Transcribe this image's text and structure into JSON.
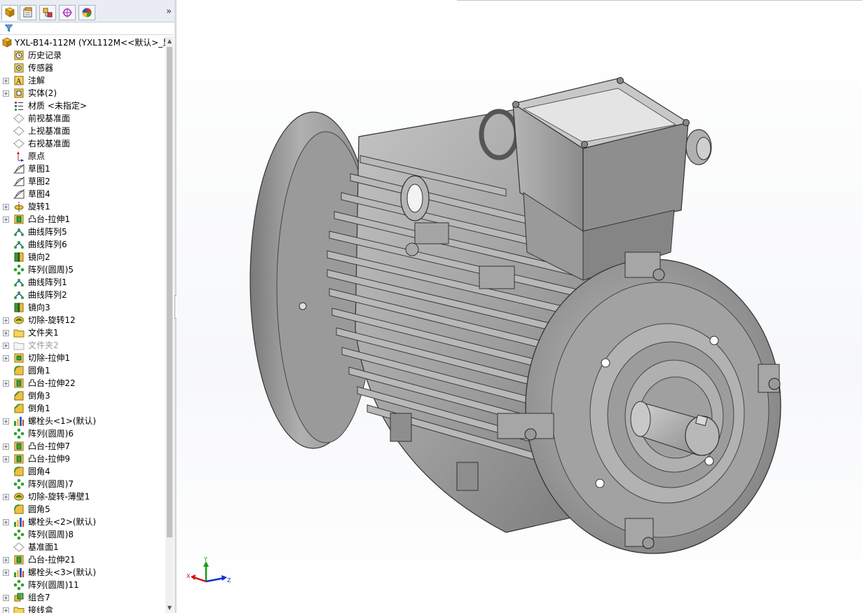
{
  "feature_tree": {
    "root_label": "YXL-B14-112M  (YXL112M<<默认>_显",
    "items": [
      {
        "label": "历史记录",
        "icon": "history-icon",
        "expandable": false
      },
      {
        "label": "传感器",
        "icon": "sensor-icon",
        "expandable": false
      },
      {
        "label": "注解",
        "icon": "annotation-icon",
        "expandable": true
      },
      {
        "label": "实体(2)",
        "icon": "solid-bodies-icon",
        "expandable": true
      },
      {
        "label": "材质 <未指定>",
        "icon": "material-icon",
        "expandable": false
      },
      {
        "label": "前视基准面",
        "icon": "plane-icon",
        "expandable": false
      },
      {
        "label": "上视基准面",
        "icon": "plane-icon",
        "expandable": false
      },
      {
        "label": "右视基准面",
        "icon": "plane-icon",
        "expandable": false
      },
      {
        "label": "原点",
        "icon": "origin-icon",
        "expandable": false
      },
      {
        "label": "草图1",
        "icon": "sketch-icon",
        "expandable": false
      },
      {
        "label": "草图2",
        "icon": "sketch-icon",
        "expandable": false
      },
      {
        "label": "草图4",
        "icon": "sketch-icon",
        "expandable": false
      },
      {
        "label": "旋转1",
        "icon": "revolve-icon",
        "expandable": true
      },
      {
        "label": "凸台-拉伸1",
        "icon": "extrude-icon",
        "expandable": true
      },
      {
        "label": "曲线阵列5",
        "icon": "curve-pattern-icon",
        "expandable": false
      },
      {
        "label": "曲线阵列6",
        "icon": "curve-pattern-icon",
        "expandable": false
      },
      {
        "label": "镜向2",
        "icon": "mirror-icon",
        "expandable": false
      },
      {
        "label": "阵列(圆周)5",
        "icon": "circular-pattern-icon",
        "expandable": false
      },
      {
        "label": "曲线阵列1",
        "icon": "curve-pattern-icon",
        "expandable": false
      },
      {
        "label": "曲线阵列2",
        "icon": "curve-pattern-icon",
        "expandable": false
      },
      {
        "label": "镜向3",
        "icon": "mirror-icon",
        "expandable": false
      },
      {
        "label": "切除-旋转12",
        "icon": "cut-revolve-icon",
        "expandable": true
      },
      {
        "label": "文件夹1",
        "icon": "folder-icon",
        "expandable": true
      },
      {
        "label": "文件夹2",
        "icon": "folder-empty-icon",
        "expandable": true,
        "dim": true
      },
      {
        "label": "切除-拉伸1",
        "icon": "cut-extrude-icon",
        "expandable": true
      },
      {
        "label": "圆角1",
        "icon": "fillet-icon",
        "expandable": false
      },
      {
        "label": "凸台-拉伸22",
        "icon": "extrude-icon",
        "expandable": true
      },
      {
        "label": "倒角3",
        "icon": "chamfer-icon",
        "expandable": false
      },
      {
        "label": "倒角1",
        "icon": "chamfer-icon",
        "expandable": false
      },
      {
        "label": "螺栓头<1>(默认)",
        "icon": "library-feature-icon",
        "expandable": true
      },
      {
        "label": "阵列(圆周)6",
        "icon": "circular-pattern-icon",
        "expandable": false
      },
      {
        "label": "凸台-拉伸7",
        "icon": "extrude-icon",
        "expandable": true
      },
      {
        "label": "凸台-拉伸9",
        "icon": "extrude-icon",
        "expandable": true
      },
      {
        "label": "圆角4",
        "icon": "fillet-icon",
        "expandable": false
      },
      {
        "label": "阵列(圆周)7",
        "icon": "circular-pattern-icon",
        "expandable": false
      },
      {
        "label": "切除-旋转-薄壁1",
        "icon": "cut-revolve-icon",
        "expandable": true
      },
      {
        "label": "圆角5",
        "icon": "fillet-icon",
        "expandable": false
      },
      {
        "label": "螺栓头<2>(默认)",
        "icon": "library-feature-icon",
        "expandable": true
      },
      {
        "label": "阵列(圆周)8",
        "icon": "circular-pattern-icon",
        "expandable": false
      },
      {
        "label": "基准面1",
        "icon": "plane-icon",
        "expandable": false
      },
      {
        "label": "凸台-拉伸21",
        "icon": "extrude-icon",
        "expandable": true
      },
      {
        "label": "螺栓头<3>(默认)",
        "icon": "library-feature-icon",
        "expandable": true
      },
      {
        "label": "阵列(圆周)11",
        "icon": "circular-pattern-icon",
        "expandable": false
      },
      {
        "label": "组合7",
        "icon": "combine-icon",
        "expandable": true
      },
      {
        "label": "接线盒",
        "icon": "folder-icon",
        "expandable": true
      }
    ]
  },
  "panel_tabs": [
    {
      "name": "featuremanager-tab",
      "icon": "feature-tree-icon"
    },
    {
      "name": "propertymanager-tab",
      "icon": "property-manager-icon"
    },
    {
      "name": "configurationmanager-tab",
      "icon": "configuration-icon"
    },
    {
      "name": "dimxpert-tab",
      "icon": "dimxpert-icon"
    },
    {
      "name": "display-manager-tab",
      "icon": "display-manager-icon"
    }
  ],
  "panel_expand_glyph": "»",
  "triad": {
    "x": "X",
    "y": "Y",
    "z": "Z"
  },
  "colors": {
    "panel_border": "#a9a9a9",
    "model_gray": "#9a9a9a",
    "triad_x": "#d01010",
    "triad_y": "#10a010",
    "triad_z": "#1030d0"
  }
}
